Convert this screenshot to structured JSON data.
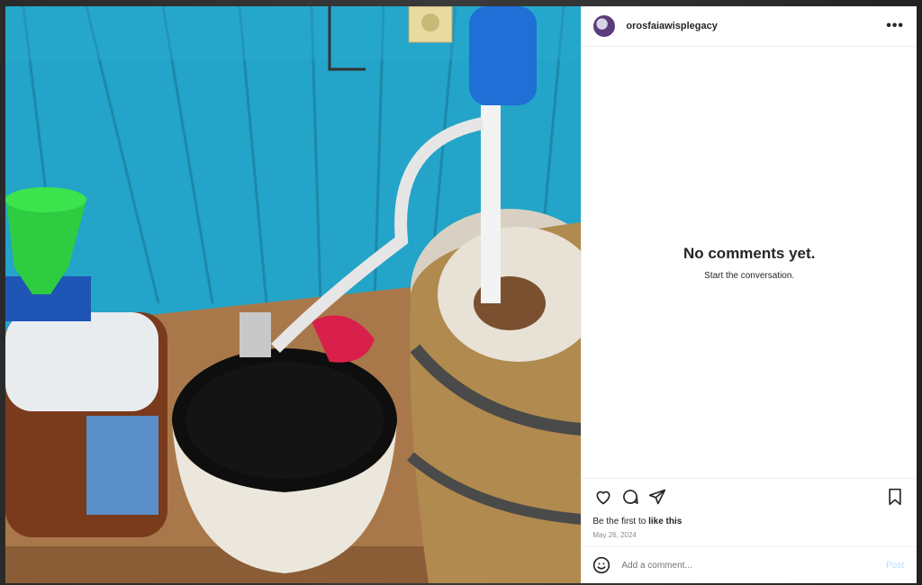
{
  "post": {
    "username": "orosfaiawisplegacy",
    "more_label": "•••",
    "image_description_icon": "photo-icon"
  },
  "comments": {
    "empty_title": "No comments yet.",
    "empty_subtitle": "Start the conversation."
  },
  "actions": {
    "like_icon": "heart-icon",
    "comment_icon": "comment-icon",
    "share_icon": "send-icon",
    "save_icon": "bookmark-icon",
    "likes_prefix": "Be the first to",
    "likes_link": "like this",
    "date": "May 26, 2024"
  },
  "composer": {
    "emoji_icon": "emoji-icon",
    "placeholder": "Add a comment...",
    "post_label": "Post"
  },
  "colors": {
    "wall": "#21a6c9",
    "post_button_disabled": "#b3dbff"
  }
}
